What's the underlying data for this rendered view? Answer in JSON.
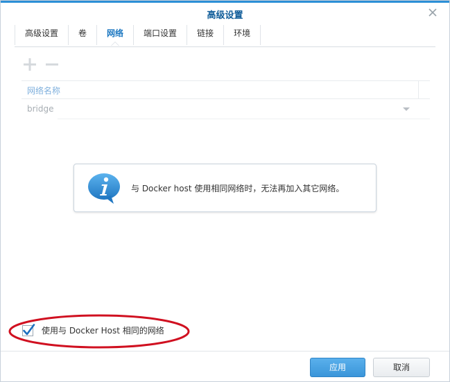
{
  "dialog": {
    "title": "高级设置"
  },
  "tabs": [
    {
      "label": "高级设置",
      "active": false
    },
    {
      "label": "卷",
      "active": false
    },
    {
      "label": "网络",
      "active": true
    },
    {
      "label": "端口设置",
      "active": false
    },
    {
      "label": "链接",
      "active": false
    },
    {
      "label": "环境",
      "active": false
    }
  ],
  "toolbar": {
    "add_icon": "plus-icon",
    "remove_icon": "minus-icon"
  },
  "network_grid": {
    "header": "网络名称",
    "rows": [
      {
        "name": "bridge"
      }
    ]
  },
  "info_tooltip": {
    "icon": "info-icon",
    "text": "与 Docker host 使用相同网络时，无法再加入其它网络。"
  },
  "host_network_option": {
    "checked": true,
    "label": "使用与 Docker Host 相同的网络"
  },
  "buttons": {
    "apply": "应用",
    "cancel": "取消"
  },
  "colors": {
    "accent": "#2b8fd6",
    "title": "#0f5c99",
    "annotation_ellipse": "#d01020"
  }
}
